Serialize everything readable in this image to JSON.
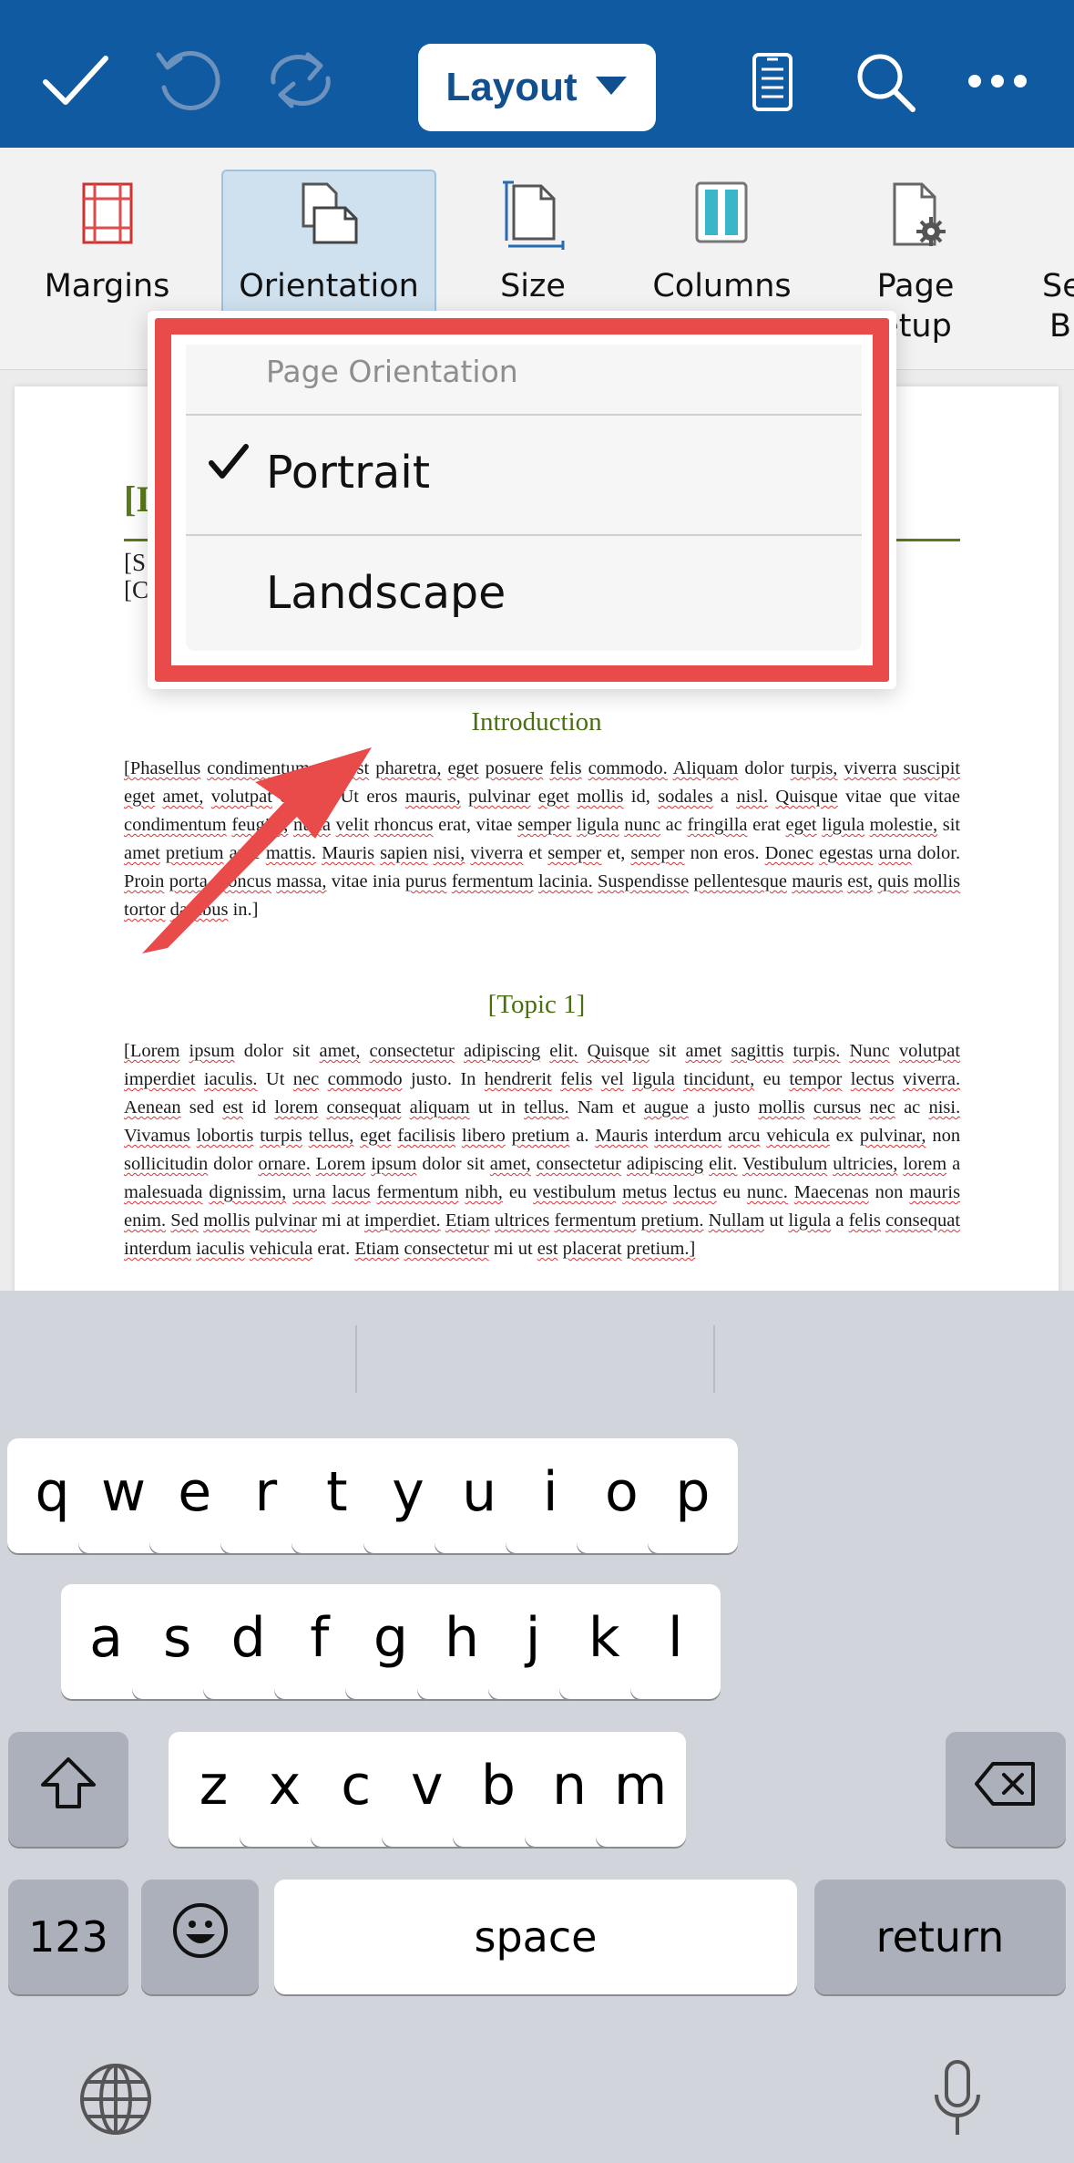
{
  "toolbar": {
    "icons": [
      "checkmark-icon",
      "undo-icon",
      "redo-icon",
      "mobile-view-icon",
      "search-icon",
      "more-icon"
    ],
    "layout_label": "Layout"
  },
  "ribbon": {
    "items": [
      {
        "label": "Margins",
        "icon": "margins-icon"
      },
      {
        "label": "Orientation",
        "icon": "orientation-icon",
        "selected": true
      },
      {
        "label": "Size",
        "icon": "size-icon"
      },
      {
        "label": "Columns",
        "icon": "columns-icon"
      },
      {
        "label_line1": "Page",
        "label_line2": "etup",
        "icon": "page-setup-icon"
      },
      {
        "label_line1": "Se",
        "label_line2": "Bi"
      }
    ]
  },
  "document": {
    "title_fragment": "[I",
    "line_s": "[S",
    "line_c": "[C",
    "intro_heading": "Introduction",
    "intro_para": "[Phasellus condimentum nec est pharetra, eget posuere felis commodo. Aliquam dolor turpis, viverra suscipit eget amet, volutpat et nisl. Ut eros mauris, pulvinar eget mollis id, sodales a nisl. Quisque vitae que vitae condimentum feugiat, nulla velit rhoncus erat, vitae semper ligula nunc ac fringilla erat eget ligula molestie, sit amet pretium ante mattis. Mauris sapien nisi, viverra et semper et, semper non eros. Donec egestas urna dolor. Proin porta rhoncus massa, vitae inia purus fermentum lacinia. Suspendisse pellentesque mauris est, quis mollis tortor dapibus in.]",
    "topic_heading": "[Topic 1]",
    "topic_para": "[Lorem ipsum dolor sit amet, consectetur adipiscing elit. Quisque sit amet sagittis turpis. Nunc volutpat imperdiet iaculis. Ut nec commodo justo. In hendrerit felis vel ligula tincidunt, eu tempor lectus viverra. Aenean sed est id lorem consequat aliquam ut in tellus. Nam et augue a justo mollis cursus nec ac nisi. Vivamus lobortis turpis tellus, eget facilisis libero pretium a. Mauris interdum arcu vehicula ex pulvinar, non sollicitudin dolor ornare. Lorem ipsum dolor sit amet, consectetur adipiscing elit. Vestibulum ultricies, lorem a malesuada dignissim, urna lacus fermentum nibh, eu vestibulum metus lectus eu nunc. Maecenas non mauris enim. Sed mollis pulvinar mi at imperdiet. Etiam ultrices fermentum pretium. Nullam ut ligula a felis consequat interdum iaculis vehicula erat. Etiam consectetur mi ut est placerat pretium.]"
  },
  "popover": {
    "title": "Page Orientation",
    "options": [
      {
        "label": "Portrait",
        "checked": true
      },
      {
        "label": "Landscape",
        "checked": false
      }
    ],
    "highlight_color": "#e94a4a"
  },
  "keyboard": {
    "row1": [
      "q",
      "w",
      "e",
      "r",
      "t",
      "y",
      "u",
      "i",
      "o",
      "p"
    ],
    "row2": [
      "a",
      "s",
      "d",
      "f",
      "g",
      "h",
      "j",
      "k",
      "l"
    ],
    "row3": [
      "z",
      "x",
      "c",
      "v",
      "b",
      "n",
      "m"
    ],
    "numbers_label": "123",
    "space_label": "space",
    "return_label": "return",
    "icons": [
      "shift-icon",
      "backspace-icon",
      "emoji-icon",
      "globe-icon",
      "microphone-icon"
    ]
  },
  "colors": {
    "toolbar_bg": "#0f5aa0",
    "accent_green": "#5a7a18",
    "arrow_red": "#e94a4a"
  }
}
